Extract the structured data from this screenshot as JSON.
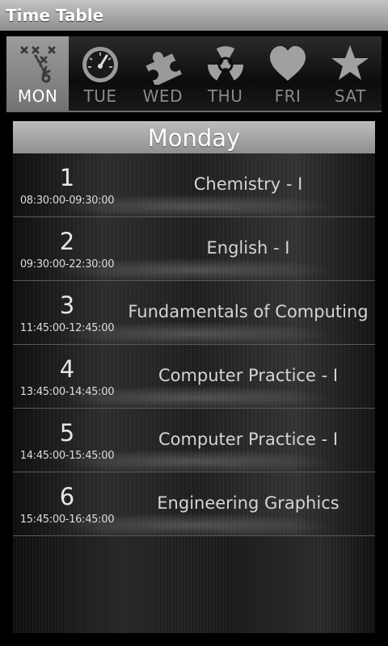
{
  "app": {
    "title": "Time Table"
  },
  "tabs": [
    {
      "label": "MON",
      "icon": "playbook-icon",
      "active": true
    },
    {
      "label": "TUE",
      "icon": "gauge-icon",
      "active": false
    },
    {
      "label": "WED",
      "icon": "puzzle-icon",
      "active": false
    },
    {
      "label": "THU",
      "icon": "radiation-icon",
      "active": false
    },
    {
      "label": "FRI",
      "icon": "heart-icon",
      "active": false
    },
    {
      "label": "SAT",
      "icon": "star-icon",
      "active": false
    }
  ],
  "day": {
    "title": "Monday"
  },
  "periods": [
    {
      "number": "1",
      "time": "08:30:00-09:30:00",
      "subject": "Chemistry - I"
    },
    {
      "number": "2",
      "time": "09:30:00-22:30:00",
      "subject": "English - I"
    },
    {
      "number": "3",
      "time": "11:45:00-12:45:00",
      "subject": "Fundamentals of Computing"
    },
    {
      "number": "4",
      "time": "13:45:00-14:45:00",
      "subject": "Computer Practice - I"
    },
    {
      "number": "5",
      "time": "14:45:00-15:45:00",
      "subject": "Computer Practice - I"
    },
    {
      "number": "6",
      "time": "15:45:00-16:45:00",
      "subject": "Engineering Graphics"
    }
  ]
}
